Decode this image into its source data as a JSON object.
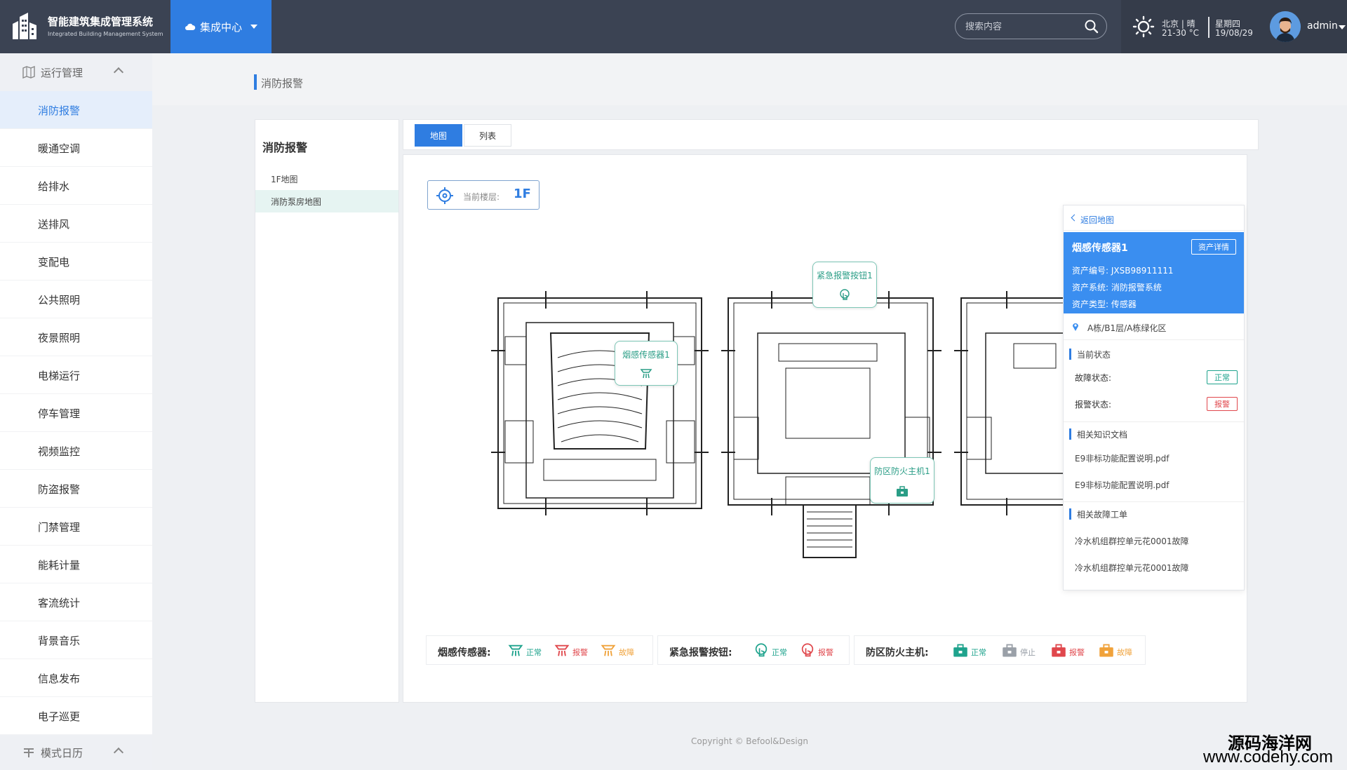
{
  "header": {
    "app_title": "智能建筑集成管理系统",
    "app_subtitle": "Integrated Building Management System",
    "nav_center_label": "集成中心",
    "search_placeholder": "搜索内容",
    "weather": {
      "city_weather": "北京 | 晴",
      "temperature": "21-30 °C",
      "weekday": "星期四",
      "date": "19/08/29"
    },
    "user_name": "admin"
  },
  "sidebar": {
    "group1_label": "运行管理",
    "items": [
      {
        "label": "消防报警",
        "active": true
      },
      {
        "label": "暖通空调"
      },
      {
        "label": "给排水"
      },
      {
        "label": "送排风"
      },
      {
        "label": "变配电"
      },
      {
        "label": "公共照明"
      },
      {
        "label": "夜景照明"
      },
      {
        "label": "电梯运行"
      },
      {
        "label": "停车管理"
      },
      {
        "label": "视频监控"
      },
      {
        "label": "防盗报警"
      },
      {
        "label": "门禁管理"
      },
      {
        "label": "能耗计量"
      },
      {
        "label": "客流统计"
      },
      {
        "label": "背景音乐"
      },
      {
        "label": "信息发布"
      },
      {
        "label": "电子巡更"
      }
    ],
    "group2_label": "模式日历"
  },
  "breadcrumb": "消防报警",
  "left_panel": {
    "title": "消防报警",
    "items": [
      {
        "label": "1F地图"
      },
      {
        "label": "消防泵房地图",
        "active": true
      }
    ]
  },
  "tabs": [
    {
      "label": "地图",
      "active": true
    },
    {
      "label": "列表"
    }
  ],
  "floor": {
    "label": "当前楼层:",
    "value": "1F"
  },
  "markers": {
    "smoke": "烟感传感器1",
    "emergency": "紧急报警按钮1",
    "host": "防区防火主机1"
  },
  "detail": {
    "back_label": "返回地图",
    "title": "烟感传感器1",
    "asset_detail_button": "资产详情",
    "asset_no": "资产编号: JXSB98911111",
    "asset_system": "资产系统: 消防报警系统",
    "asset_type": "资产类型: 传感器",
    "location": "A栋/B1层/A栋绿化区",
    "status_title": "当前状态",
    "fault_label": "故障状态:",
    "fault_value": "正常",
    "alarm_label": "报警状态:",
    "alarm_value": "报警",
    "docs_title": "相关知识文档",
    "docs": [
      "E9非标功能配置说明.pdf",
      "E9非标功能配置说明.pdf"
    ],
    "orders_title": "相关故障工单",
    "orders": [
      "冷水机组群控单元花0001故障",
      "冷水机组群控单元花0001故障"
    ]
  },
  "legend": {
    "smoke": {
      "title": "烟感传感器:",
      "normal": "正常",
      "alarm": "报警",
      "fault": "故障"
    },
    "emergency": {
      "title": "紧急报警按钮:",
      "normal": "正常",
      "alarm": "报警"
    },
    "host": {
      "title": "防区防火主机:",
      "normal": "正常",
      "stop": "停止",
      "alarm": "报警",
      "fault": "故障"
    }
  },
  "colors": {
    "primary": "#2f7de1",
    "normal": "#1fa38d",
    "alarm": "#e0474c",
    "fault": "#f0a23a",
    "stop": "#9aa0a8"
  },
  "copyright": "Copyright © Befool&Design",
  "watermark": {
    "line1": "源码海洋网",
    "line2": "www.codehy.com"
  }
}
